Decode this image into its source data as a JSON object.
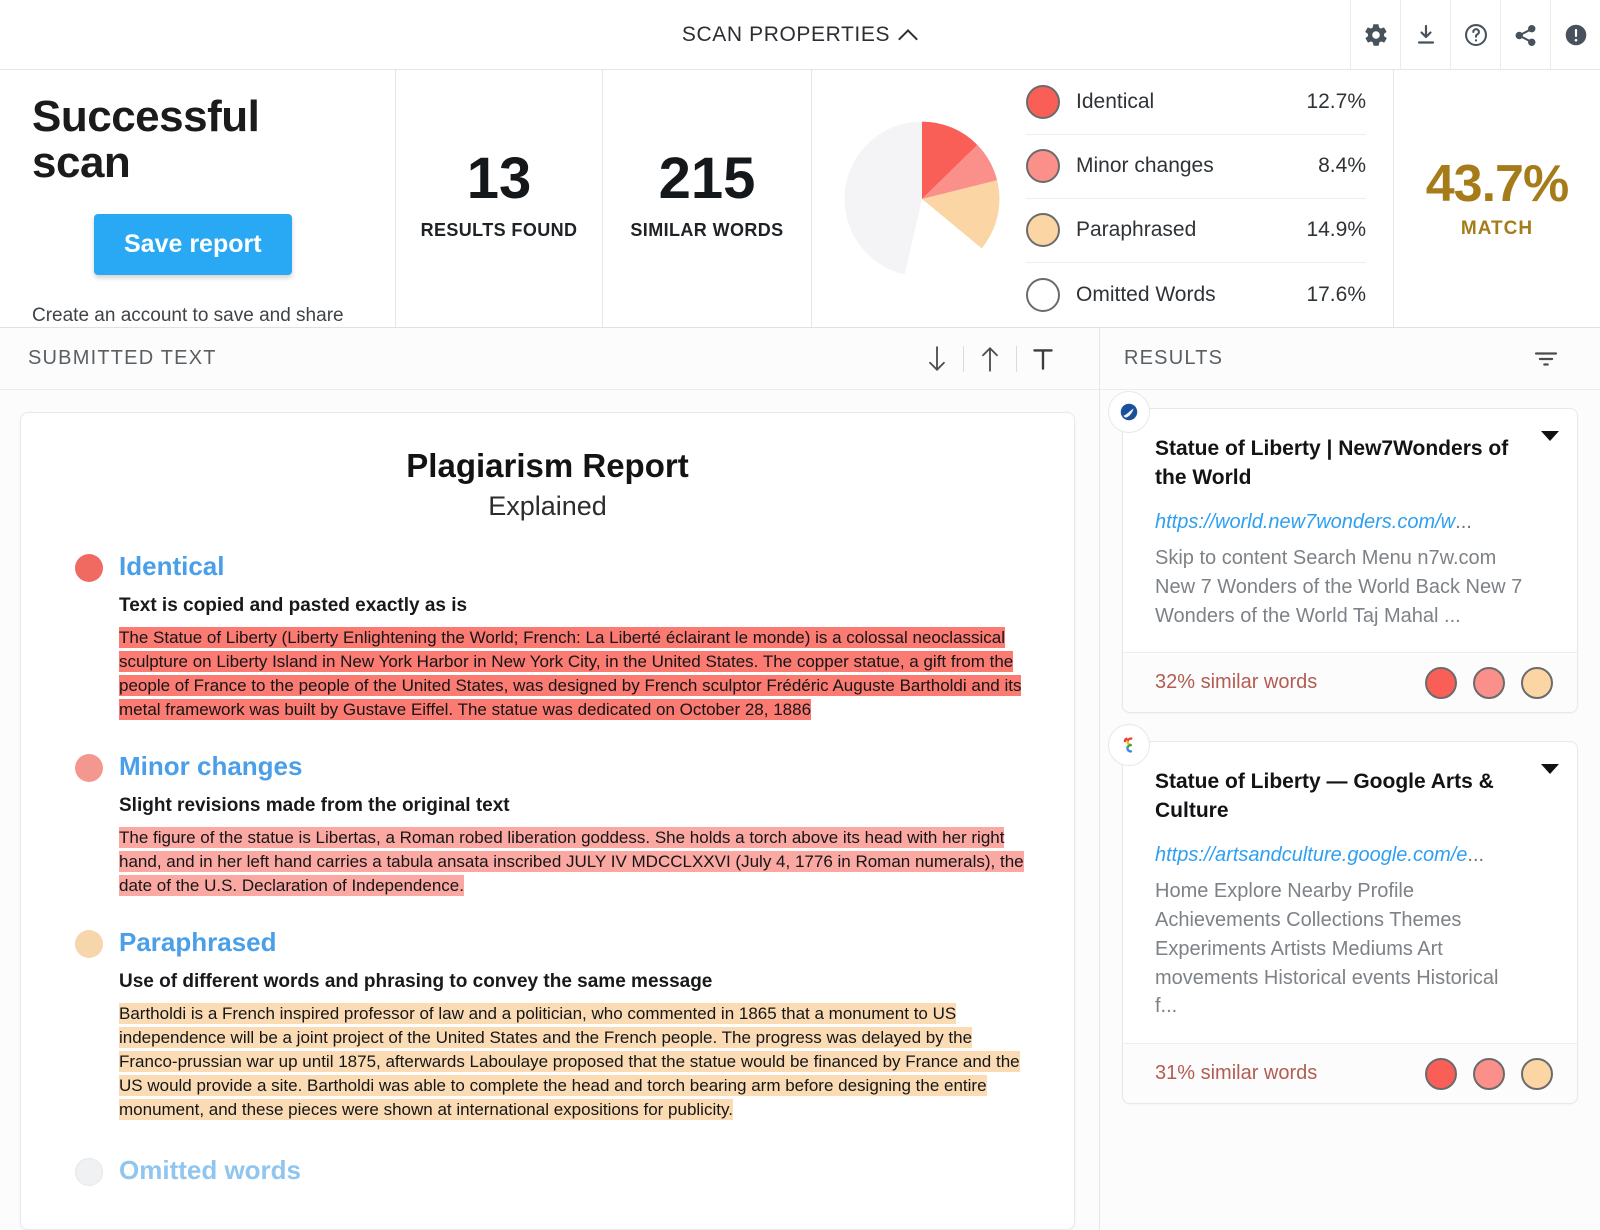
{
  "topbar": {
    "title": "SCAN PROPERTIES",
    "collapse_icon": "chevron-up-icon",
    "icons": [
      "gear-icon",
      "download-icon",
      "help-circle-icon",
      "share-icon",
      "info-circle-icon"
    ]
  },
  "summary": {
    "status_title": "Successful scan",
    "save_label": "Save report",
    "status_note": "Create an account to save and share",
    "stats": [
      {
        "value": "13",
        "label": "RESULTS FOUND"
      },
      {
        "value": "215",
        "label": "SIMILAR WORDS"
      }
    ],
    "match_value": "43.7%",
    "match_label": "MATCH",
    "match_color": "#a67c1b"
  },
  "chart_data": {
    "type": "pie",
    "title": "",
    "categories": [
      "Identical",
      "Minor changes",
      "Paraphrased",
      "Omitted Words",
      "Unmatched"
    ],
    "values": [
      12.7,
      8.4,
      14.9,
      17.6,
      46.4
    ],
    "value_labels": [
      "12.7%",
      "8.4%",
      "14.9%",
      "17.6%",
      ""
    ],
    "colors": [
      "#fa5f57",
      "#fb908a",
      "#fbd5a4",
      "#ffffff",
      "#f4f4f6"
    ],
    "legend_position": "right",
    "legend": [
      {
        "label": "Identical",
        "value": "12.7%",
        "color": "#fa5f57"
      },
      {
        "label": "Minor changes",
        "value": "8.4%",
        "color": "#fb908a"
      },
      {
        "label": "Paraphrased",
        "value": "14.9%",
        "color": "#fbd5a4"
      },
      {
        "label": "Omitted Words",
        "value": "17.6%",
        "color": "#ffffff"
      }
    ],
    "total_match": "43.7%"
  },
  "left": {
    "pane_title": "SUBMITTED TEXT",
    "tools": [
      "arrow-down-icon",
      "arrow-up-icon",
      "text-format-icon"
    ],
    "doc": {
      "title": "Plagiarism Report",
      "subtitle": "Explained",
      "sections": [
        {
          "dot_color": "#f06a62",
          "heading": "Identical",
          "description": "Text is copied and pasted exactly as is",
          "highlight_class": "hl-identical",
          "body": "The Statue of Liberty (Liberty Enlightening the World; French: La Liberté éclairant le monde) is a colossal neoclassical sculpture on Liberty Island in New York Harbor in New York City, in the United States. The copper statue, a gift from the people of France to the people of the United States, was designed by French sculptor Frédéric Auguste Bartholdi and its metal framework was built by Gustave Eiffel. The statue was dedicated on October 28, 1886"
        },
        {
          "dot_color": "#f4988f",
          "heading": "Minor changes",
          "description": "Slight revisions made from the original text",
          "highlight_class": "hl-minor",
          "body": "The figure of the statue is Libertas, a Roman robed liberation goddess. She holds a torch above its head with her right hand, and in her left hand carries a tabula ansata inscribed JULY IV MDCCLXXVI (July 4, 1776 in Roman numerals), the date of the U.S. Declaration of Independence."
        },
        {
          "dot_color": "#f6d6aa",
          "heading": "Paraphrased",
          "description": "Use of different words and phrasing to convey the same message",
          "highlight_class": "hl-para",
          "body": "Bartholdi is a French inspired professor of law and a politician, who commented in 1865 that a monument to US independence will be a joint project of the United States and the French people. The progress was delayed by the Franco-prussian war up until 1875, afterwards Laboulaye proposed that the statue would be financed by France and the US would provide a site. Bartholdi was able to complete the head and torch bearing arm before designing the entire monument, and these pieces were shown at international expositions for publicity."
        },
        {
          "dot_color": "#eceef0",
          "heading": "Omitted words",
          "description": "",
          "highlight_class": "",
          "body": ""
        }
      ]
    }
  },
  "right": {
    "pane_title": "RESULTS",
    "filter_icon": "filter-icon",
    "cards": [
      {
        "favicon": "new7wonders-globe-icon",
        "title": "Statue of Liberty | New7Wonders of the World",
        "url": "https://world.new7wonders.com/w",
        "url_ellipsis": "...",
        "snippet": "Skip to content Search Menu n7w.com New 7 Wonders of the World Back New 7 Wonders of the World Taj Mahal ...",
        "similar": "32% similar words",
        "dot_colors": [
          "#fa5f57",
          "#fb908a",
          "#fbd5a4"
        ]
      },
      {
        "favicon": "google-arts-culture-icon",
        "title": "Statue of Liberty — Google Arts & Culture",
        "url": "https://artsandculture.google.com/e",
        "url_ellipsis": "...",
        "snippet": "Home Explore Nearby Profile Achievements Collections Themes Experiments Artists Mediums Art movements Historical events Historical f...",
        "similar": "31% similar words",
        "dot_colors": [
          "#fa5f57",
          "#fb908a",
          "#fbd5a4"
        ]
      }
    ]
  }
}
